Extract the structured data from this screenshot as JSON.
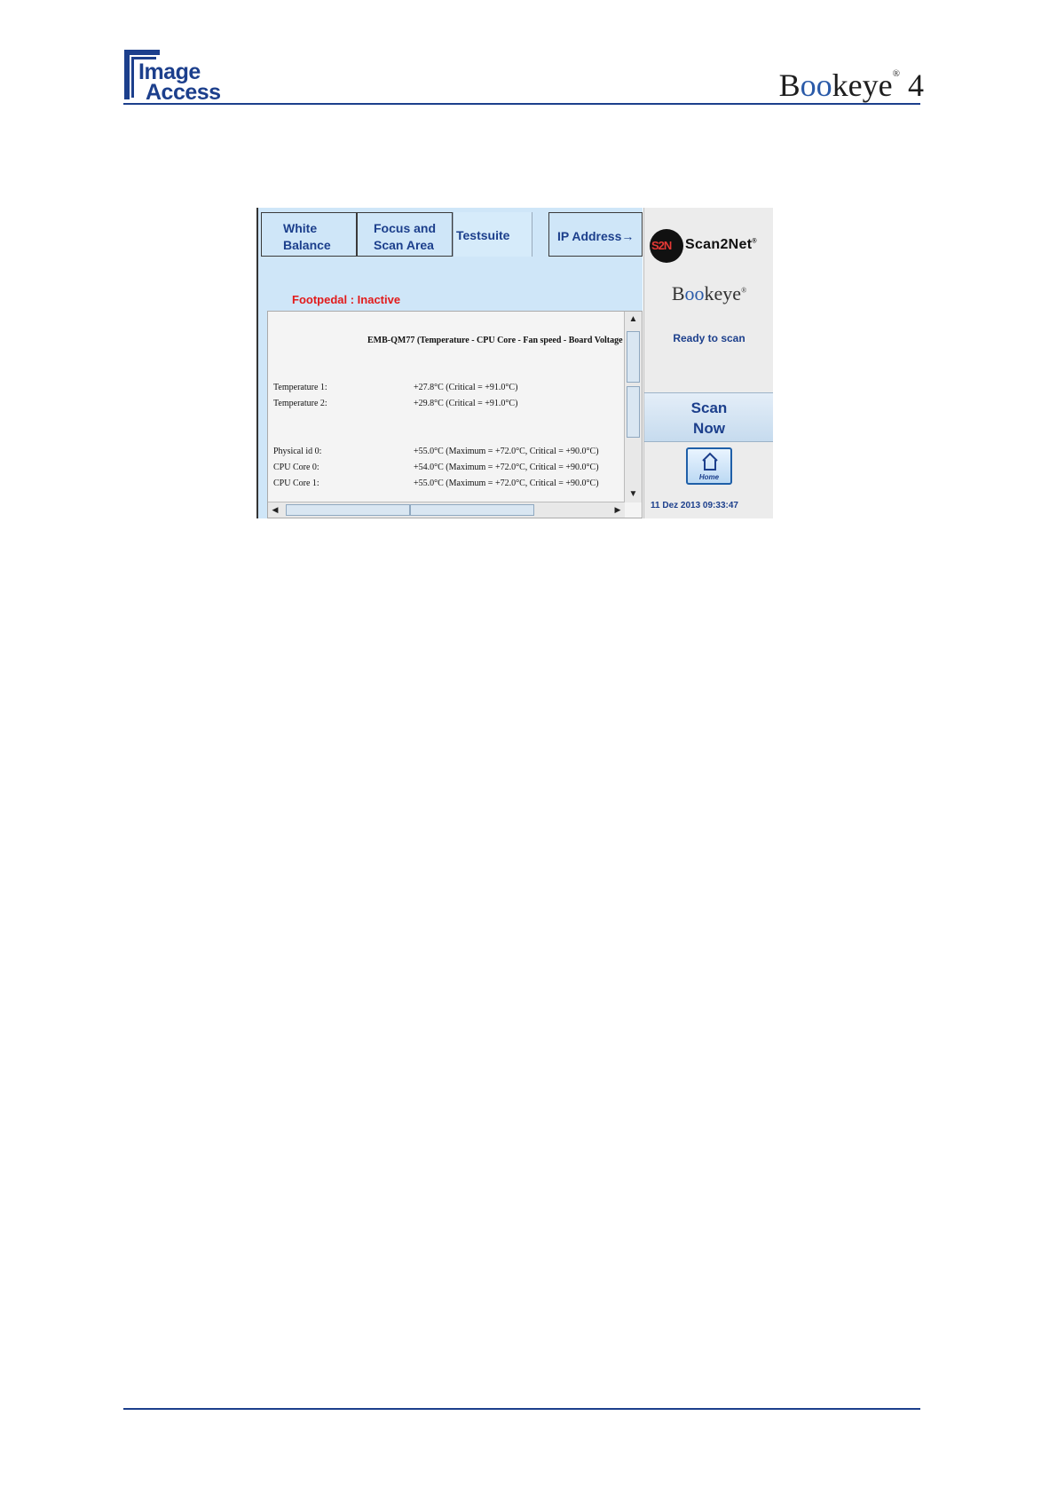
{
  "header": {
    "company_logo_line1": "Image",
    "company_logo_line2": "Access",
    "product_logo_pre": "B",
    "product_logo_oo": "oo",
    "product_logo_post": "keye",
    "product_logo_reg": "®",
    "product_logo_version": "4"
  },
  "screenshot": {
    "tabs": [
      {
        "line1": "White",
        "line2": "Balance"
      },
      {
        "line1": "Focus and",
        "line2": "Scan Area"
      },
      {
        "label": "Testsuite"
      },
      {
        "label": "IP Address→"
      }
    ],
    "footpedal_status": "Footpedal : Inactive",
    "log": {
      "title": "EMB-QM77 (Temperature - CPU Core - Fan speed - Board Voltage",
      "rows": [
        {
          "key": "Temperature 1:",
          "value": "+27.8°C (Critical = +91.0°C)"
        },
        {
          "key": "Temperature 2:",
          "value": "+29.8°C (Critical = +91.0°C)"
        },
        {
          "key": "Physical id 0:",
          "value": "+55.0°C (Maximum = +72.0°C, Critical = +90.0°C)"
        },
        {
          "key": "CPU Core 0:",
          "value": "+54.0°C (Maximum = +72.0°C, Critical = +90.0°C)"
        },
        {
          "key": "CPU Core 1:",
          "value": "+55.0°C (Maximum = +72.0°C, Critical = +90.0°C)"
        }
      ]
    },
    "side": {
      "s2n_badge": "S2N",
      "s2n_brand": "Scan2Net",
      "s2n_reg": "®",
      "bookeye_pre": "B",
      "bookeye_oo": "oo",
      "bookeye_post": "keye",
      "bookeye_reg": "®",
      "status": "Ready to scan",
      "scan_line1": "Scan",
      "scan_line2": "Now",
      "home_label": "Home",
      "datetime": "11 Dez 2013 09:33:47"
    },
    "icons": {
      "scroll_up": "triangle-up",
      "scroll_down": "triangle-down",
      "scroll_left": "triangle-left",
      "scroll_right": "triangle-right",
      "home": "home-icon"
    }
  }
}
